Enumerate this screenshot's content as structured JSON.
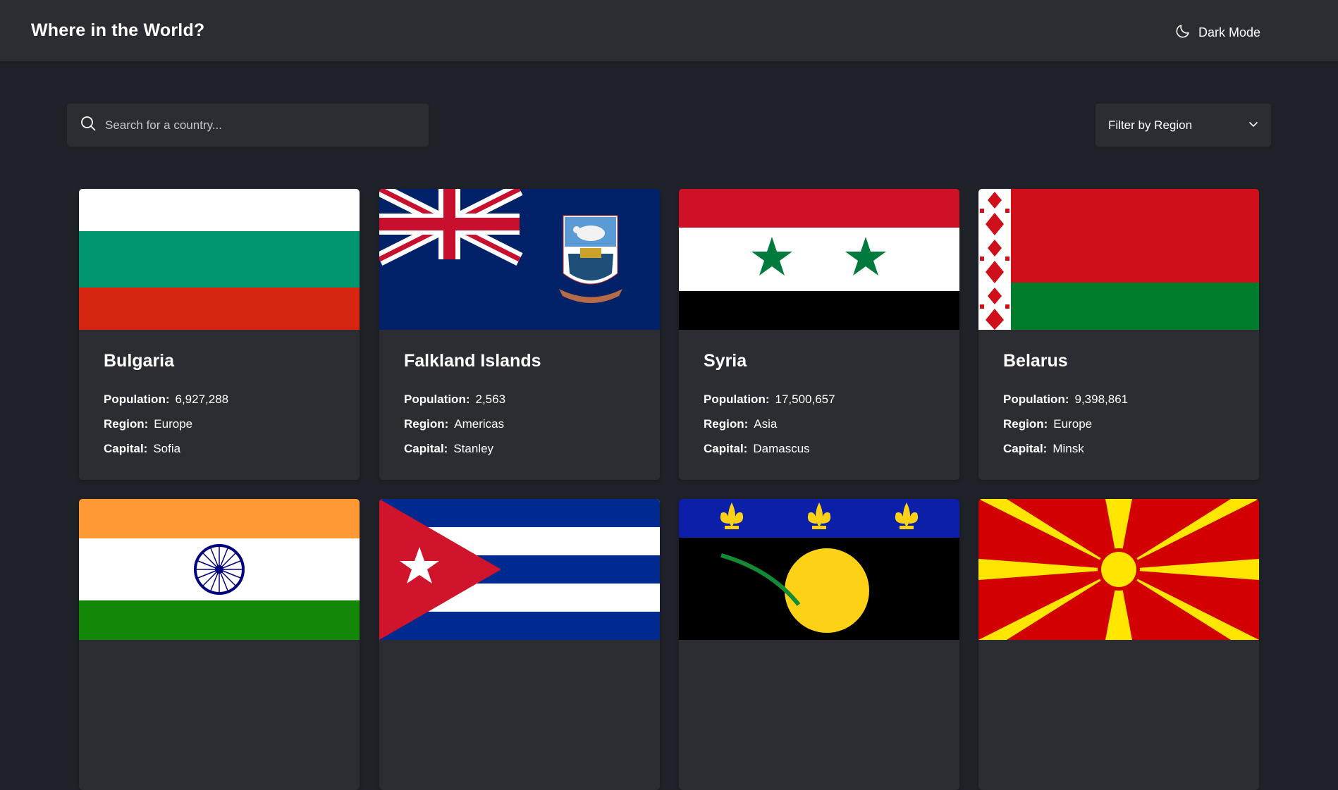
{
  "header": {
    "title": "Where in the World?",
    "theme_toggle_label": "Dark Mode"
  },
  "search": {
    "placeholder": "Search for a country...",
    "value": ""
  },
  "filter": {
    "label": "Filter by Region"
  },
  "labels": {
    "population": "Population:",
    "region": "Region:",
    "capital": "Capital:"
  },
  "countries": [
    {
      "name": "Bulgaria",
      "population": "6,927,288",
      "region": "Europe",
      "capital": "Sofia"
    },
    {
      "name": "Falkland Islands",
      "population": "2,563",
      "region": "Americas",
      "capital": "Stanley"
    },
    {
      "name": "Syria",
      "population": "17,500,657",
      "region": "Asia",
      "capital": "Damascus"
    },
    {
      "name": "Belarus",
      "population": "9,398,861",
      "region": "Europe",
      "capital": "Minsk"
    }
  ],
  "colors": {
    "background": "#202229",
    "surface": "#2b2d33",
    "text": "#ffffff"
  },
  "icons": {
    "theme": "moon-icon",
    "search": "search-icon",
    "filter": "chevron-down-icon"
  }
}
